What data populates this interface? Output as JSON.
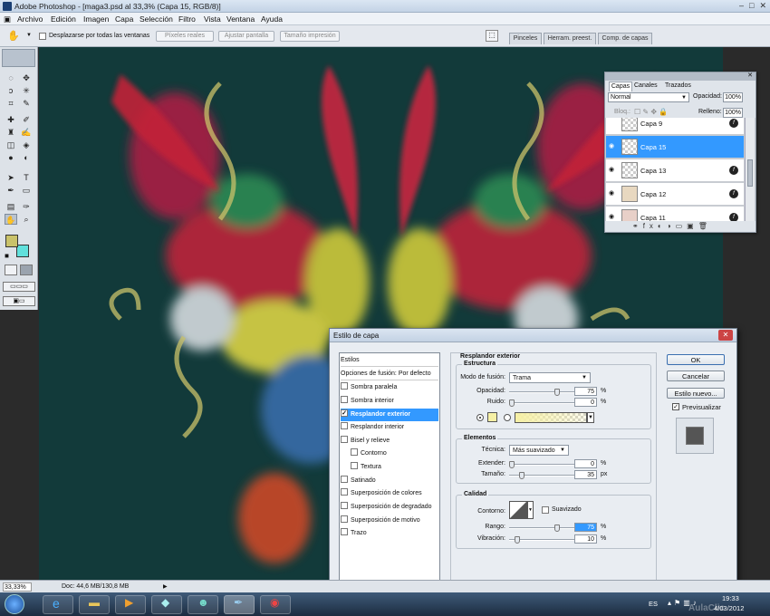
{
  "window": {
    "title": "Adobe Photoshop - [maga3.psd al 33,3% (Capa 15, RGB/8)]",
    "min": "–",
    "max": "□",
    "close": "✕"
  },
  "menu": [
    "Archivo",
    "Edición",
    "Imagen",
    "Capa",
    "Selección",
    "Filtro",
    "Vista",
    "Ventana",
    "Ayuda"
  ],
  "options": {
    "scroll_all": "Desplazarse por todas las ventanas",
    "btn_pixels": "Píxeles reales",
    "btn_fit": "Ajustar pantalla",
    "btn_print": "Tamaño impresión"
  },
  "panel_tabs": [
    "Pinceles",
    "Herram. preest.",
    "Comp. de capas"
  ],
  "colors": {
    "foreground": "#c9c26a",
    "background": "#61e0dc",
    "accent": "#3399ff",
    "canvas": "#123a3a"
  },
  "layers_panel": {
    "tabs": [
      "Capas",
      "Canales",
      "Trazados"
    ],
    "blend_mode": "Normal",
    "opacity_label": "Opacidad:",
    "opacity_value": "100%",
    "lock_label": "Bloq.:",
    "fill_label": "Relleno:",
    "fill_value": "100%",
    "layers": [
      {
        "name": "Capa 9"
      },
      {
        "name": "Capa 15"
      },
      {
        "name": "Capa 13"
      },
      {
        "name": "Capa 12"
      },
      {
        "name": "Capa 11"
      }
    ]
  },
  "dialog": {
    "title": "Estilo de capa",
    "styles_header": "Estilos",
    "blend_options": "Opciones de fusión: Por defecto",
    "styles": [
      {
        "label": "Sombra paralela",
        "checked": false
      },
      {
        "label": "Sombra interior",
        "checked": false
      },
      {
        "label": "Resplandor exterior",
        "checked": true
      },
      {
        "label": "Resplandor interior",
        "checked": false
      },
      {
        "label": "Bisel y relieve",
        "checked": false
      },
      {
        "label": "Contorno",
        "checked": false
      },
      {
        "label": "Textura",
        "checked": false
      },
      {
        "label": "Satinado",
        "checked": false
      },
      {
        "label": "Superposición de colores",
        "checked": false
      },
      {
        "label": "Superposición de degradado",
        "checked": false
      },
      {
        "label": "Superposición de motivo",
        "checked": false
      },
      {
        "label": "Trazo",
        "checked": false
      }
    ],
    "section_title": "Resplandor exterior",
    "estructura": {
      "title": "Estructura",
      "blend_label": "Modo de fusión:",
      "blend_value": "Trama",
      "opacity_label": "Opacidad:",
      "opacity_value": "75",
      "noise_label": "Ruido:",
      "noise_value": "0",
      "unit": "%"
    },
    "elementos": {
      "title": "Elementos",
      "technique_label": "Técnica:",
      "technique_value": "Más suavizado",
      "spread_label": "Extender:",
      "spread_value": "0",
      "size_label": "Tamaño:",
      "size_value": "35",
      "px": "px"
    },
    "calidad": {
      "title": "Calidad",
      "contour_label": "Contorno:",
      "smooth_label": "Suavizado",
      "range_label": "Rango:",
      "range_value": "75",
      "jitter_label": "Vibración:",
      "jitter_value": "10"
    },
    "buttons": {
      "ok": "OK",
      "cancel": "Cancelar",
      "new_style": "Estilo nuevo...",
      "preview": "Previsualizar"
    }
  },
  "status": {
    "zoom": "33,33%",
    "doc": "Doc: 44,6 MB/130,8 MB"
  },
  "taskbar": {
    "lang": "ES",
    "time": "19:33",
    "date": "4/03/2012",
    "watermark": "AulaClic"
  }
}
